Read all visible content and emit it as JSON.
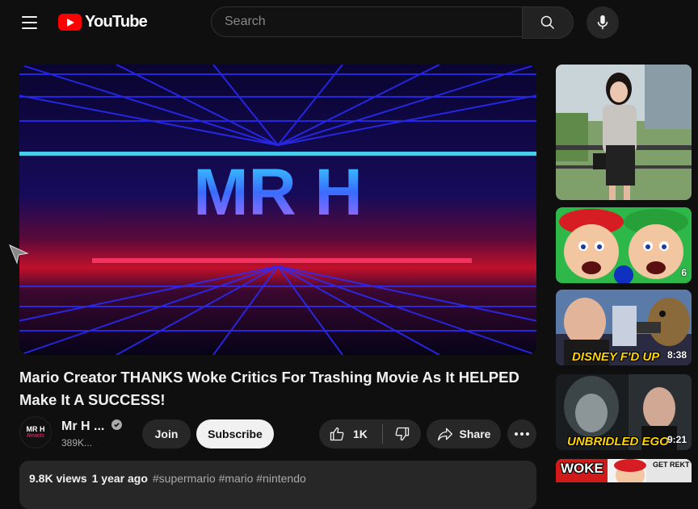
{
  "header": {
    "logo_text": "YouTube",
    "search_placeholder": "Search",
    "icons": [
      "menu-icon",
      "search-icon",
      "mic-icon"
    ]
  },
  "video": {
    "player_overlay_text": "MR H",
    "title": "Mario Creator THANKS Woke Critics For Trashing Movie As It HELPED Make It A SUCCESS!",
    "channel_name": "Mr H ...",
    "avatar_text": "MR H",
    "avatar_subtext": "Reacts",
    "subscribers": "389K...",
    "join_label": "Join",
    "subscribe_label": "Subscribe",
    "like_count": "1K",
    "share_label": "Share",
    "views": "9.8K views",
    "date": "1 year ago",
    "hashtags": "#supermario #mario #nintendo"
  },
  "recommendations": [
    {
      "duration": "",
      "overlay": ""
    },
    {
      "duration": "6",
      "overlay": ""
    },
    {
      "duration": "8:38",
      "overlay": "DISNEY F'D UP"
    },
    {
      "duration": "9:21",
      "overlay": "UNBRIDLED EGO"
    },
    {
      "duration": "",
      "overlay": "WOKE",
      "overlay2": "GET REKT"
    }
  ],
  "colors": {
    "background": "#0f0f0f",
    "brand_red": "#ff0000",
    "pill_bg": "#272727",
    "subscribe_bg": "#f1f1f1"
  }
}
